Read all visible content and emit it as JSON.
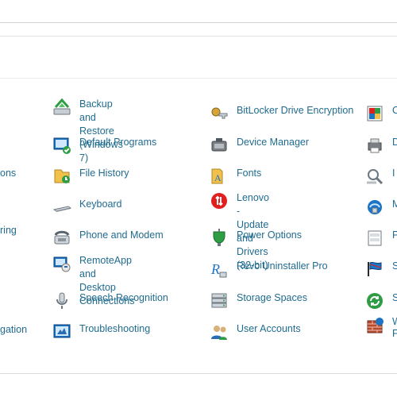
{
  "control_panel": {
    "items": {
      "backup_restore": "Backup and Restore\n(Windows 7)",
      "bitlocker": "BitLocker Drive Encryption",
      "default_programs": "Default Programs",
      "device_manager": "Device Manager",
      "file_history": "File History",
      "fonts": "Fonts",
      "keyboard": "Keyboard",
      "lenovo_update": "Lenovo - Update and\nDrivers (32-bit)",
      "phone_modem": "Phone and Modem",
      "power_options": "Power Options",
      "remoteapp": "RemoteApp and Desktop\nConnections",
      "revo": "Revo Uninstaller Pro",
      "speech": "Speech Recognition",
      "storage_spaces": "Storage Spaces",
      "troubleshooting": "Troubleshooting",
      "user_accounts": "User Accounts"
    },
    "left_cut": {
      "row3": "ons",
      "row5": "ring",
      "row9": "gation"
    },
    "right_cut": {
      "r1": "C",
      "r2": "D",
      "r3": "I",
      "r4": "M",
      "r5": "P",
      "r6": "S",
      "r7": "S",
      "r8": "W\nF"
    }
  }
}
